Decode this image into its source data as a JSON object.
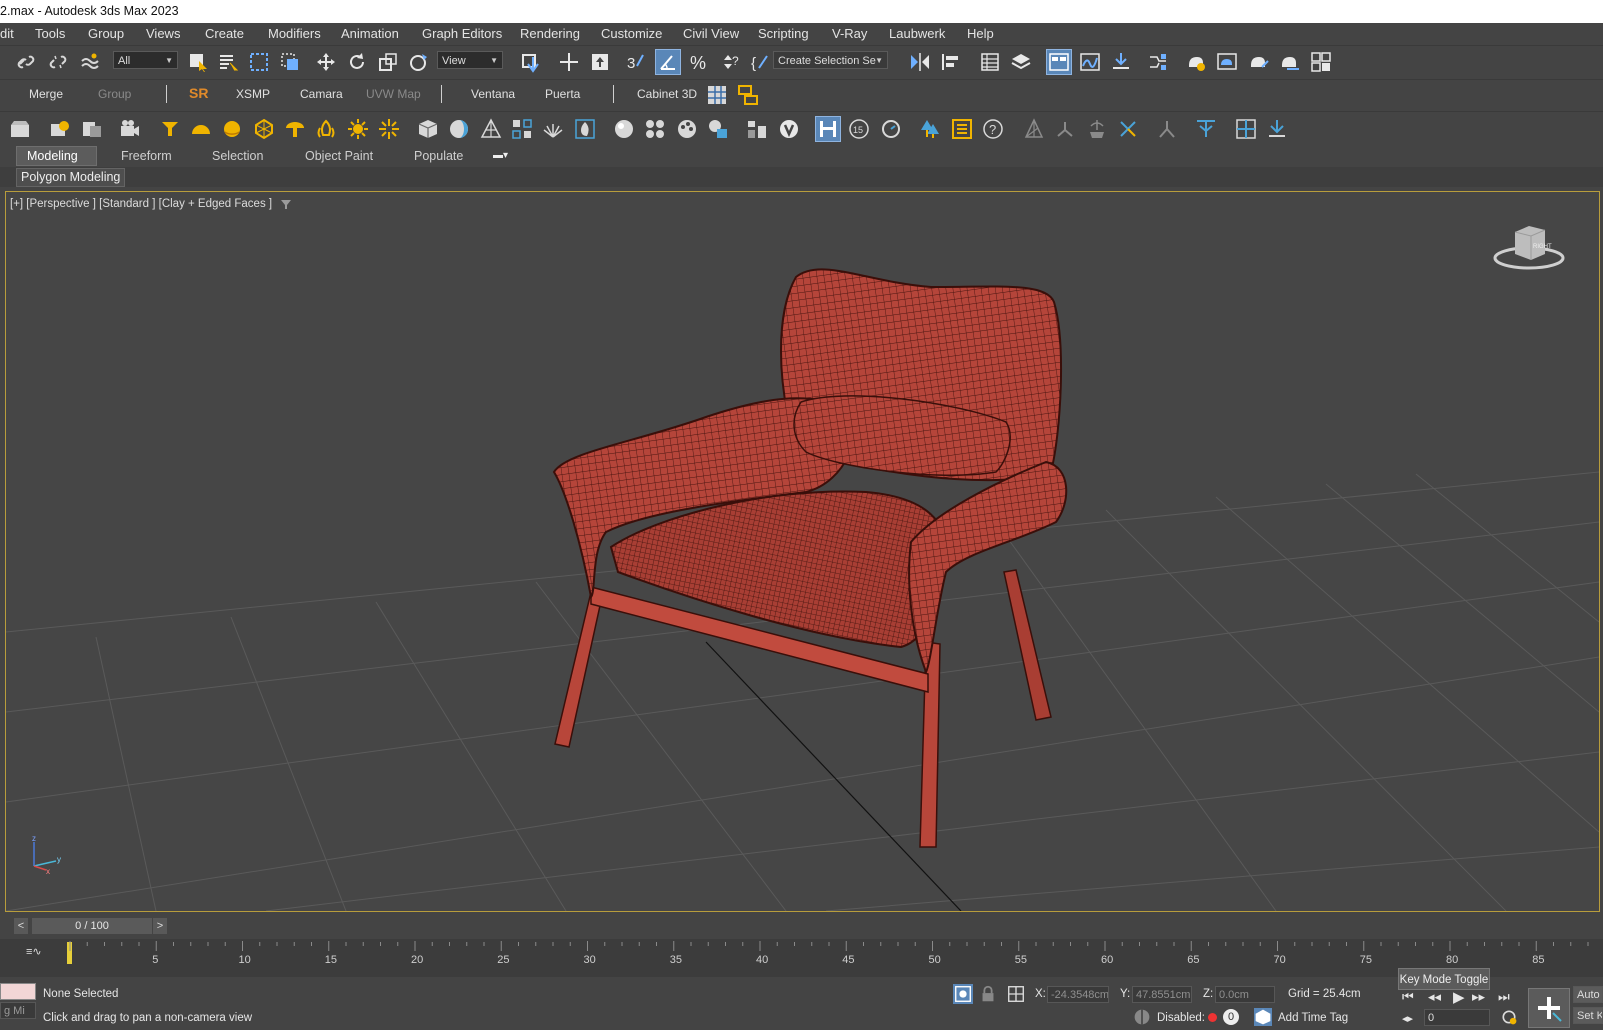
{
  "window": {
    "title": "2.max - Autodesk 3ds Max 2023"
  },
  "menu": [
    "dit",
    "Tools",
    "Group",
    "Views",
    "Create",
    "Modifiers",
    "Animation",
    "Graph Editors",
    "Rendering",
    "Customize",
    "Civil View",
    "Scripting",
    "V-Ray",
    "Laubwerk",
    "Help"
  ],
  "main_toolbar": {
    "selection_filter": "All",
    "ref_coord": "View",
    "selection_set": "Create Selection Se"
  },
  "custom_toolbar": {
    "items": [
      "Merge",
      "Group",
      "SR",
      "XSMP",
      "Camara",
      "UVW Map",
      "Ventana",
      "Puerta",
      "Cabinet 3D"
    ]
  },
  "ribbon": {
    "tabs": [
      "Modeling",
      "Freeform",
      "Selection",
      "Object Paint",
      "Populate"
    ],
    "active_tab": "Modeling",
    "panel": "Polygon Modeling"
  },
  "viewport": {
    "label": "[+] [Perspective ] [Standard ] [Clay + Edged Faces ]",
    "navcube_face": "RIGHT",
    "object_color": "#b5453a",
    "axis_labels": [
      "z",
      "x",
      "y"
    ]
  },
  "timeline": {
    "frame_display": "0 / 100",
    "prev": "<",
    "next": ">",
    "ticks": [
      5,
      10,
      15,
      20,
      25,
      30,
      35,
      40,
      45,
      50,
      55,
      60,
      65,
      70,
      75,
      80,
      85
    ]
  },
  "status": {
    "maxscript_mini": "g Mi",
    "selection": "None Selected",
    "prompt": "Click and drag to pan a non-camera view",
    "x_label": "X:",
    "x_value": "-24.3548cm",
    "y_label": "Y:",
    "y_value": "47.8551cm",
    "z_label": "Z:",
    "z_value": "0.0cm",
    "grid": "Grid = 25.4cm",
    "disabled_label": "Disabled:",
    "disabled_count": "0",
    "add_time_tag": "Add Time Tag",
    "tooltip": "Key Mode Toggle",
    "frame_field": "0",
    "auto_key": "Auto",
    "set_key": "Set K"
  }
}
